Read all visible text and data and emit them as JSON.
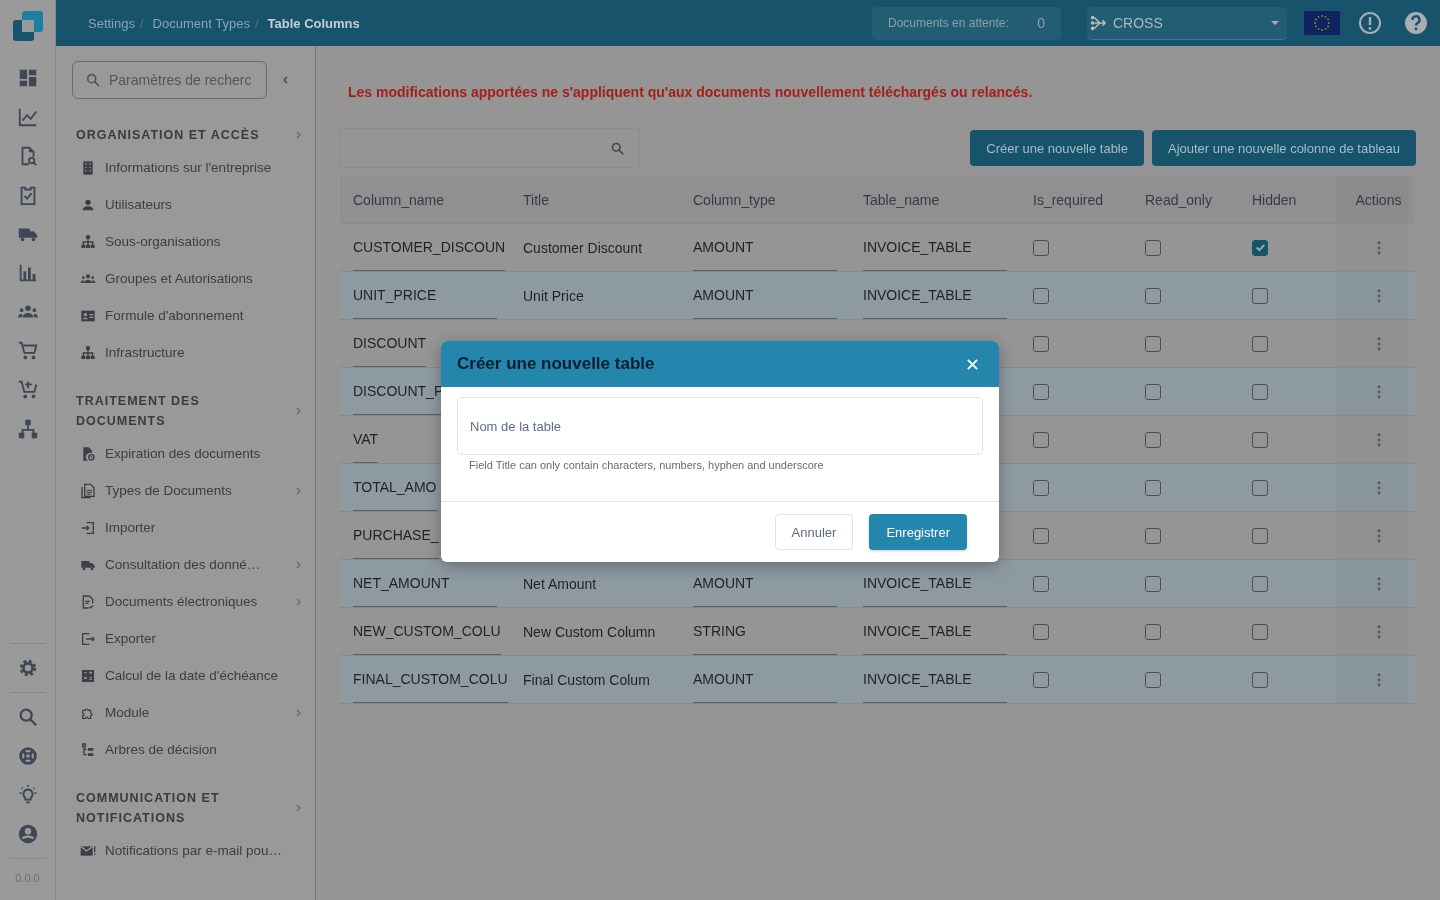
{
  "header": {
    "breadcrumbs": [
      {
        "label": "Settings",
        "current": false
      },
      {
        "separator": "/",
        "label": "Document Types",
        "current": false
      },
      {
        "separator": "/",
        "label": "Table Columns",
        "current": true
      }
    ],
    "pending": {
      "label": "Documents en attente:",
      "count": "0"
    },
    "organization": {
      "value": "CROSS"
    }
  },
  "rail": {
    "version": "0.0.0"
  },
  "sidebar": {
    "search": {
      "placeholder": "Paramètres de recherc"
    },
    "sections": [
      {
        "title": "ORGANISATION ET ACCÈS",
        "expandable": true,
        "items": [
          {
            "label": "Informations sur l'entreprise",
            "expandable": false
          },
          {
            "label": "Utilisateurs",
            "expandable": false
          },
          {
            "label": "Sous-organisations",
            "expandable": false
          },
          {
            "label": "Groupes et Autorisations",
            "expandable": false
          },
          {
            "label": "Formule d'abonnement",
            "expandable": false
          },
          {
            "label": "Infrastructure",
            "expandable": false
          }
        ]
      },
      {
        "title": "TRAITEMENT DES DOCUMENTS",
        "expandable": true,
        "items": [
          {
            "label": "Expiration des documents",
            "expandable": false
          },
          {
            "label": "Types de Documents",
            "expandable": true
          },
          {
            "label": "Importer",
            "expandable": false
          },
          {
            "label": "Consultation des donné…",
            "expandable": true
          },
          {
            "label": "Documents électroniques",
            "expandable": true
          },
          {
            "label": "Exporter",
            "expandable": false
          },
          {
            "label": "Calcul de la date d'échéance",
            "expandable": false
          },
          {
            "label": "Module",
            "expandable": true
          },
          {
            "label": "Arbres de décision",
            "expandable": false
          }
        ]
      },
      {
        "title": "COMMUNICATION ET NOTIFICATIONS",
        "expandable": true,
        "items": [
          {
            "label": "Notifications par e-mail pou…",
            "expandable": false
          }
        ]
      }
    ]
  },
  "notice": "Les modifications apportées ne s'appliquent qu'aux documents nouvellement téléchargés ou relancés.",
  "buttons": [
    "Créer une nouvelle table",
    "Ajouter une nouvelle colonne de tableau"
  ],
  "table": {
    "columns": [
      "Column_name",
      "Title",
      "Column_type",
      "Table_name",
      "Is_required",
      "Read_only",
      "Hidden",
      "Actions"
    ],
    "rows": [
      {
        "column_name": "CUSTOMER_DISCOUN",
        "title": "Customer Discount",
        "column_type": "AMOUNT",
        "table_name": "INVOICE_TABLE",
        "is_required": false,
        "read_only": false,
        "hidden": true
      },
      {
        "column_name": "UNIT_PRICE",
        "title": "Unit Price",
        "column_type": "AMOUNT",
        "table_name": "INVOICE_TABLE",
        "is_required": false,
        "read_only": false,
        "hidden": false
      },
      {
        "column_name": "DISCOUNT",
        "is_required": false,
        "read_only": false,
        "hidden": false
      },
      {
        "column_name": "DISCOUNT_P",
        "is_required": false,
        "read_only": false,
        "hidden": false
      },
      {
        "column_name": "VAT",
        "is_required": false,
        "read_only": false,
        "hidden": false
      },
      {
        "column_name": "TOTAL_AMO",
        "is_required": false,
        "read_only": false,
        "hidden": false
      },
      {
        "column_name": "PURCHASE_",
        "is_required": false,
        "read_only": false,
        "hidden": false
      },
      {
        "column_name": "NET_AMOUNT",
        "title": "Net Amount",
        "column_type": "AMOUNT",
        "table_name": "INVOICE_TABLE",
        "is_required": false,
        "read_only": false,
        "hidden": false
      },
      {
        "column_name": "NEW_CUSTOM_COLU",
        "title": "New Custom Column",
        "column_type": "STRING",
        "table_name": "INVOICE_TABLE",
        "is_required": false,
        "read_only": false,
        "hidden": false
      },
      {
        "column_name": "FINAL_CUSTOM_COLU",
        "title": "Final Custom Colum",
        "column_type": "AMOUNT",
        "table_name": "INVOICE_TABLE",
        "is_required": false,
        "read_only": false,
        "hidden": false
      }
    ]
  },
  "dialog": {
    "title": "Créer une nouvelle table",
    "field": {
      "placeholder": "Nom de la table",
      "hint": "Field Title can only contain characters, numbers, hyphen and underscore"
    },
    "buttons": [
      "Annuler",
      "Enregistrer"
    ]
  }
}
